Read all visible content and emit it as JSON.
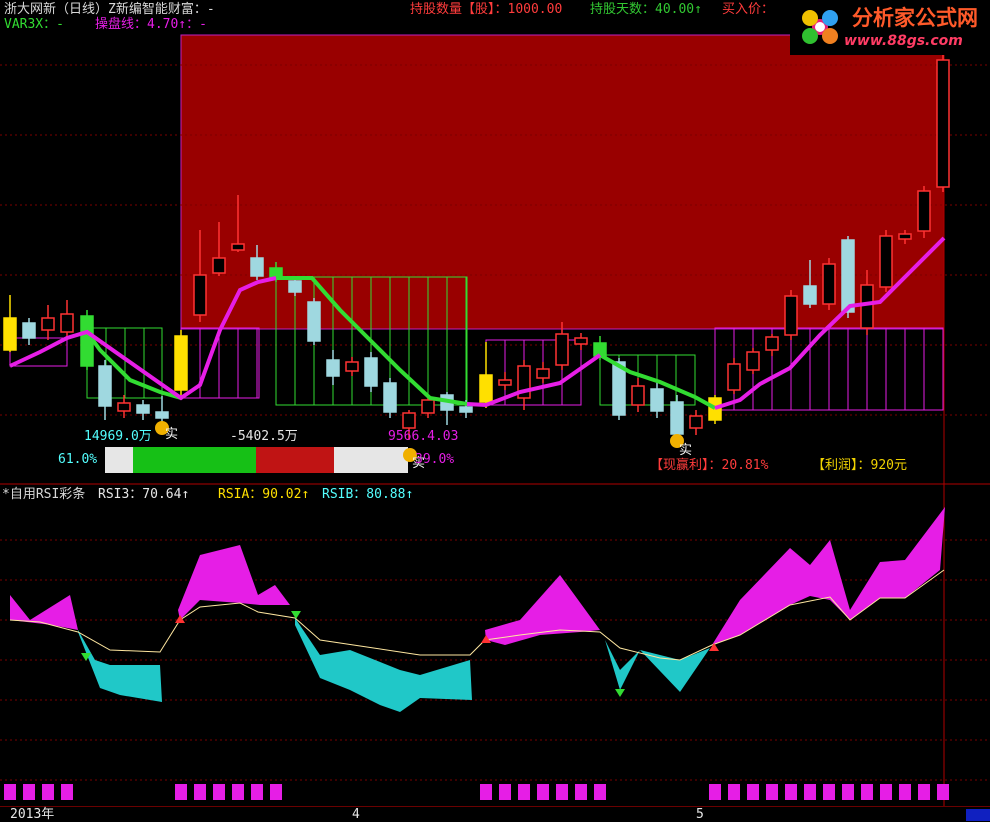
{
  "header": {
    "title": "浙大网新（日线）Z新编智能财富：-",
    "hold_qty": "持股数量【股】：1000.00",
    "hold_days": "持股天数：40.00↑",
    "buy_price": "买入价："
  },
  "line2": {
    "var3x": "VAR3X：-",
    "pan_line": "操盘线：4.70↑：-"
  },
  "logo": {
    "name": "分析家公式网",
    "url": "www.88gs.com"
  },
  "price_panel": {
    "left_val": "14969.0万",
    "mid_val": "-5402.5万",
    "right_val": "9566.4.03",
    "pct_left": "61.0%",
    "pct_right": "39.0%",
    "shi": "实",
    "profit_rate": "【现赢利】：20.81%",
    "profit_amt": "【利润】：920元"
  },
  "indicator": {
    "name": "*自用RSI彩条",
    "rsi3": "RSI3：70.64↑",
    "rsia": "RSIA：90.02↑",
    "rsib": "RSIB：80.88↑"
  },
  "axis": {
    "year": "2013年",
    "m4": "4",
    "m5": "5"
  },
  "colors": {
    "up": "#ff3232",
    "down": "#54ffff",
    "ma_green": "#32dc32",
    "ma_pink": "#e61ee6",
    "box": "#990000"
  }
}
